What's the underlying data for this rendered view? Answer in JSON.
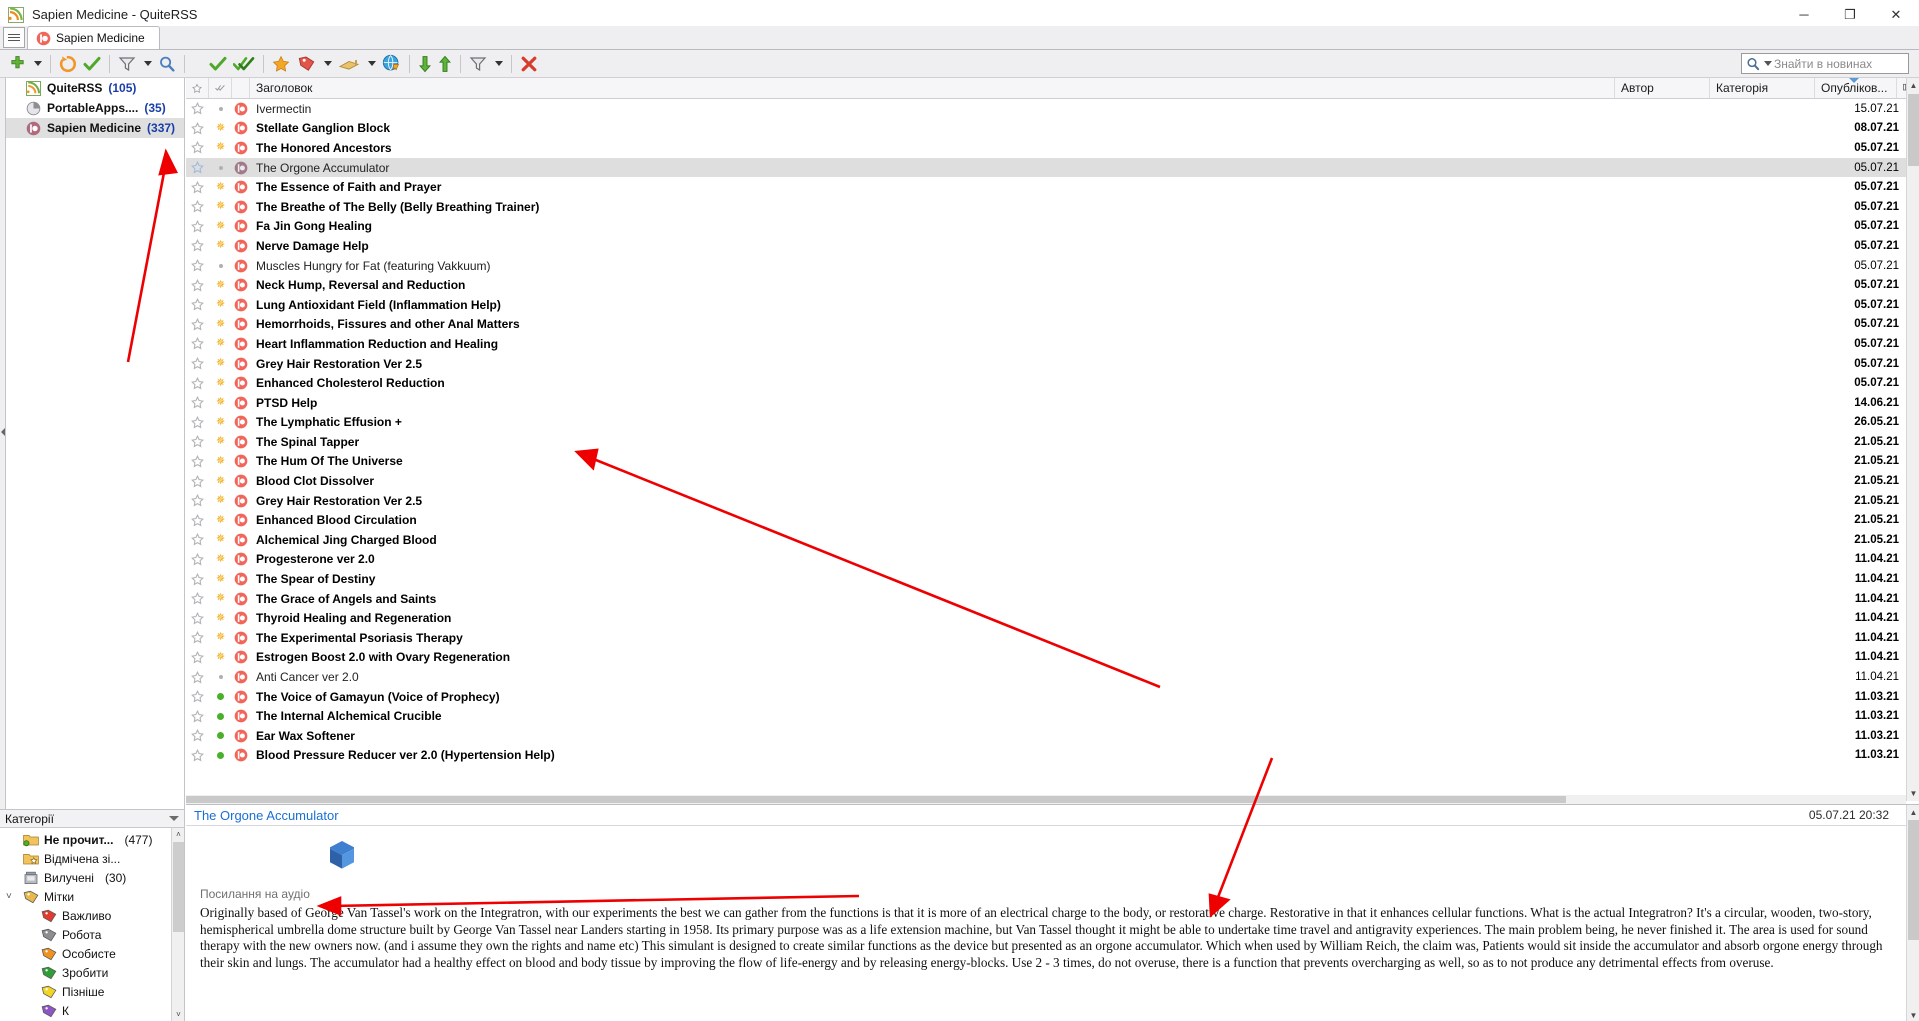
{
  "window": {
    "title": "Sapien Medicine - QuiteRSS",
    "icon": "rss-icon",
    "minimize": "─",
    "maximize": "❐",
    "close": "✕"
  },
  "tabbar": {
    "tab_list_button": "tab-list-icon",
    "tabs": [
      {
        "label": "Sapien Medicine",
        "icon": "sapien-medicine-favicon",
        "active": true
      }
    ]
  },
  "toolbar": {
    "items": [
      {
        "name": "add-feed-button",
        "icon": "plus-icon"
      },
      {
        "name": "add-feed-dropdown",
        "icon": "caret-down-icon"
      },
      {
        "name": "update-feed-button",
        "icon": "refresh-icon"
      },
      {
        "name": "mark-feed-read-button",
        "icon": "check-icon"
      },
      {
        "name": "feed-filter-button",
        "icon": "funnel-icon"
      },
      {
        "name": "feed-filter-dropdown",
        "icon": "caret-down-icon"
      },
      {
        "name": "find-feed-button",
        "icon": "magnifier-icon"
      },
      {
        "name": "mark-read-button",
        "icon": "check-icon"
      },
      {
        "name": "mark-all-read-button",
        "icon": "double-check-icon"
      },
      {
        "name": "star-button",
        "icon": "star-icon"
      },
      {
        "name": "label-button",
        "icon": "label-tag-icon"
      },
      {
        "name": "label-dropdown",
        "icon": "caret-down-icon"
      },
      {
        "name": "share-button",
        "icon": "share-icon"
      },
      {
        "name": "share-dropdown",
        "icon": "caret-down-icon"
      },
      {
        "name": "open-in-browser-button",
        "icon": "globe-icon"
      },
      {
        "name": "next-unread-button",
        "icon": "arrow-down-icon"
      },
      {
        "name": "prev-unread-button",
        "icon": "arrow-up-icon"
      },
      {
        "name": "news-filter-button",
        "icon": "funnel-icon"
      },
      {
        "name": "news-filter-dropdown",
        "icon": "caret-down-icon"
      },
      {
        "name": "delete-news-button",
        "icon": "red-x-icon"
      }
    ]
  },
  "search": {
    "placeholder": "Знайти в новинах",
    "value": ""
  },
  "feeds": {
    "items": [
      {
        "label": "QuiteRSS",
        "count": "(105)",
        "icon": "rss-star-icon",
        "selected": false
      },
      {
        "label": "PortableApps....",
        "count": "(35)",
        "icon": "portableapps-icon",
        "selected": false
      },
      {
        "label": "Sapien Medicine",
        "count": "(337)",
        "icon": "sapien-medicine-icon",
        "selected": true
      }
    ]
  },
  "categories": {
    "header": "Категорії",
    "items": [
      {
        "label": "Не прочит...",
        "count": "(477)",
        "icon": "folder-unread-icon",
        "bold": true,
        "indent": 0,
        "expander": ""
      },
      {
        "label": "Відмічена зі...",
        "count": "",
        "icon": "folder-starred-icon",
        "bold": false,
        "indent": 0,
        "expander": ""
      },
      {
        "label": "Вилучені",
        "count": "(30)",
        "icon": "trash-icon",
        "bold": false,
        "indent": 0,
        "expander": ""
      },
      {
        "label": "Мітки",
        "count": "",
        "icon": "label-tag-icon",
        "bold": false,
        "indent": 0,
        "expander": "˅"
      },
      {
        "label": "Важливо",
        "count": "",
        "icon": "label-tag-red-icon",
        "bold": false,
        "indent": 1,
        "expander": ""
      },
      {
        "label": "Робота",
        "count": "",
        "icon": "label-tag-grey-icon",
        "bold": false,
        "indent": 1,
        "expander": ""
      },
      {
        "label": "Особисте",
        "count": "",
        "icon": "label-tag-orange-icon",
        "bold": false,
        "indent": 1,
        "expander": ""
      },
      {
        "label": "Зробити",
        "count": "",
        "icon": "label-tag-green-icon",
        "bold": false,
        "indent": 1,
        "expander": ""
      },
      {
        "label": "Пізніше",
        "count": "",
        "icon": "label-tag-yellow-icon",
        "bold": false,
        "indent": 1,
        "expander": ""
      },
      {
        "label": "К",
        "count": "",
        "icon": "label-tag-purple-icon",
        "bold": false,
        "indent": 1,
        "expander": ""
      }
    ],
    "scroll_up": "˄",
    "scroll_down": "˅"
  },
  "news_list": {
    "columns": {
      "star": "star-icon",
      "read": "double-check-icon",
      "title": "Заголовок",
      "author": "Автор",
      "category": "Категорія",
      "published": "Опубліков...",
      "column_chooser": "column-chooser-icon"
    },
    "sort_column": "published",
    "sort_direction": "descending",
    "rows": [
      {
        "title": "Ivermectin",
        "date": "15.07.21",
        "state": "read",
        "selected": false
      },
      {
        "title": "Stellate Ganglion Block",
        "date": "08.07.21",
        "state": "unread",
        "selected": false
      },
      {
        "title": "The Honored Ancestors",
        "date": "05.07.21",
        "state": "unread",
        "selected": false
      },
      {
        "title": "The Orgone Accumulator",
        "date": "05.07.21",
        "state": "read",
        "selected": true
      },
      {
        "title": "The Essence of Faith and Prayer",
        "date": "05.07.21",
        "state": "unread",
        "selected": false
      },
      {
        "title": "The Breathe of The Belly (Belly Breathing Trainer)",
        "date": "05.07.21",
        "state": "unread",
        "selected": false
      },
      {
        "title": "Fa Jin Gong Healing",
        "date": "05.07.21",
        "state": "unread",
        "selected": false
      },
      {
        "title": "Nerve Damage Help",
        "date": "05.07.21",
        "state": "unread",
        "selected": false
      },
      {
        "title": "Muscles Hungry for Fat (featuring Vakkuum)",
        "date": "05.07.21",
        "state": "read",
        "selected": false
      },
      {
        "title": "Neck Hump, Reversal and Reduction",
        "date": "05.07.21",
        "state": "unread",
        "selected": false
      },
      {
        "title": "Lung Antioxidant Field (Inflammation Help)",
        "date": "05.07.21",
        "state": "unread",
        "selected": false
      },
      {
        "title": "Hemorrhoids, Fissures and other Anal Matters",
        "date": "05.07.21",
        "state": "unread",
        "selected": false
      },
      {
        "title": "Heart Inflammation Reduction and Healing",
        "date": "05.07.21",
        "state": "unread",
        "selected": false
      },
      {
        "title": "Grey Hair Restoration Ver 2.5",
        "date": "05.07.21",
        "state": "unread",
        "selected": false
      },
      {
        "title": "Enhanced Cholesterol Reduction",
        "date": "05.07.21",
        "state": "unread",
        "selected": false
      },
      {
        "title": "PTSD Help",
        "date": "14.06.21",
        "state": "unread",
        "selected": false
      },
      {
        "title": "The Lymphatic Effusion +",
        "date": "26.05.21",
        "state": "unread",
        "selected": false
      },
      {
        "title": "The Spinal Tapper",
        "date": "21.05.21",
        "state": "unread",
        "selected": false
      },
      {
        "title": "The Hum Of The Universe",
        "date": "21.05.21",
        "state": "unread",
        "selected": false
      },
      {
        "title": "Blood Clot Dissolver",
        "date": "21.05.21",
        "state": "unread",
        "selected": false
      },
      {
        "title": "Grey Hair Restoration Ver 2.5",
        "date": "21.05.21",
        "state": "unread",
        "selected": false
      },
      {
        "title": "Enhanced Blood Circulation",
        "date": "21.05.21",
        "state": "unread",
        "selected": false
      },
      {
        "title": "Alchemical Jing Charged Blood",
        "date": "21.05.21",
        "state": "unread",
        "selected": false
      },
      {
        "title": "Progesterone ver 2.0",
        "date": "11.04.21",
        "state": "unread",
        "selected": false
      },
      {
        "title": "The Spear of Destiny",
        "date": "11.04.21",
        "state": "unread",
        "selected": false
      },
      {
        "title": "The Grace of Angels and Saints",
        "date": "11.04.21",
        "state": "unread",
        "selected": false
      },
      {
        "title": "Thyroid Healing and Regeneration",
        "date": "11.04.21",
        "state": "unread",
        "selected": false
      },
      {
        "title": "The Experimental Psoriasis Therapy",
        "date": "11.04.21",
        "state": "unread",
        "selected": false
      },
      {
        "title": "Estrogen Boost 2.0 with Ovary Regeneration",
        "date": "11.04.21",
        "state": "unread",
        "selected": false
      },
      {
        "title": "Anti Cancer ver 2.0",
        "date": "11.04.21",
        "state": "read",
        "selected": false
      },
      {
        "title": "The Voice of Gamayun (Voice of Prophecy)",
        "date": "11.03.21",
        "state": "green",
        "selected": false
      },
      {
        "title": "The Internal Alchemical Crucible",
        "date": "11.03.21",
        "state": "green",
        "selected": false
      },
      {
        "title": "Ear Wax Softener",
        "date": "11.03.21",
        "state": "green",
        "selected": false
      },
      {
        "title": "Blood Pressure Reducer ver 2.0 (Hypertension Help)",
        "date": "11.03.21",
        "state": "green",
        "selected": false
      }
    ]
  },
  "preview": {
    "title": "The Orgone Accumulator",
    "date": "05.07.21 20:32",
    "image_icon": "blue-cube-icon",
    "link_label": "Посилання на аудіо",
    "body": "Originally based of George Van Tassel's work on the Integratron, with our experiments the best we can gather from the functions is that it is more of an electrical charge to the body, or restorative charge.  Restorative in that it enhances cellular functions.  What is the actual Integratron? It's a circular, wooden, two-story, hemispherical umbrella dome structure built by George Van Tassel near Landers starting in 1958. Its primary purpose was as a life extension machine, but Van Tassel thought it might be able to undertake time travel and antigravity experiences. The main problem being, he never finished it. The area is used for sound therapy with the new owners now. (and i assume they own the rights and name etc) This simulant is designed to create similar functions as the device but presented as an  orgone accumulator. Which when used by William Reich, the claim was,  Patients would sit inside the accumulator and absorb orgone energy through their skin and lungs. The accumulator had a healthy effect on blood and body tissue by improving the flow of life-energy and by releasing energy-blocks. Use 2 - 3 times, do not overuse, there is a function that prevents overcharging as well, so as to not produce any detrimental effects from overuse."
  },
  "colors": {
    "accent_blue": "#1a6fd4",
    "count_blue": "#1a3ea8",
    "selection_grey": "#dedede",
    "annotation_red": "#ee0000",
    "unread_orange": "#f0a500",
    "green_dot": "#4caf2a"
  }
}
